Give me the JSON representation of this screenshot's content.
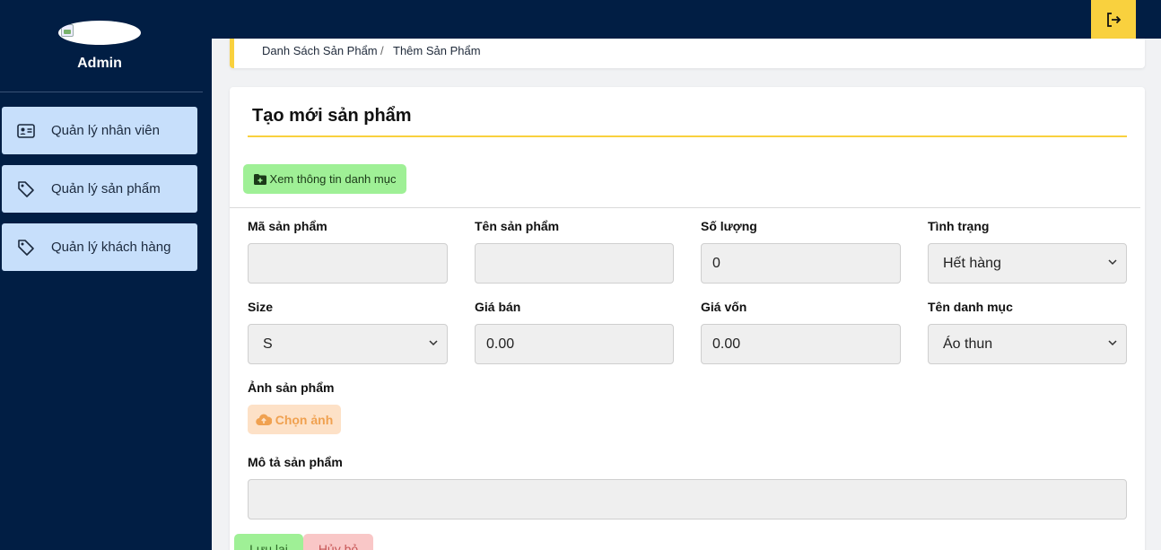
{
  "sidebar": {
    "admin_name": "Admin",
    "items": [
      {
        "label": "Quản lý nhân viên",
        "icon": "id-card-icon"
      },
      {
        "label": "Quản lý sản phẩm",
        "icon": "tag-icon"
      },
      {
        "label": "Quản lý khách hàng",
        "icon": "tag-icon"
      }
    ]
  },
  "topbar": {
    "logout_icon": "logout-icon"
  },
  "breadcrumb": {
    "items": [
      "Danh Sách Sản Phẩm",
      "Thêm Sản Phẩm"
    ],
    "separator": "/"
  },
  "form": {
    "title": "Tạo mới sản phẩm",
    "view_category_button": "Xem thông tin danh mục",
    "fields": {
      "code": {
        "label": "Mã sản phẩm",
        "value": ""
      },
      "name": {
        "label": "Tên sản phẩm",
        "value": ""
      },
      "quantity": {
        "label": "Số lượng",
        "value": "0"
      },
      "status": {
        "label": "Tình trạng",
        "value": "Hết hàng"
      },
      "size": {
        "label": "Size",
        "value": "S"
      },
      "price": {
        "label": "Giá bán",
        "value": "0.00"
      },
      "cost": {
        "label": "Giá vốn",
        "value": "0.00"
      },
      "category": {
        "label": "Tên danh mục",
        "value": "Áo thun"
      },
      "image": {
        "label": "Ảnh sản phẩm",
        "button": "Chọn ảnh"
      },
      "description": {
        "label": "Mô tả sản phẩm",
        "value": ""
      }
    },
    "save_button": "Lưu lại",
    "cancel_button": "Hủy bỏ"
  },
  "colors": {
    "sidebar_bg": "#011e44",
    "accent_yellow": "#f9d13e",
    "sidebar_item_bg": "#c7dffb",
    "green_button": "#9ff096",
    "orange_button": "#fde1c7",
    "red_button": "#f9c7c7"
  }
}
